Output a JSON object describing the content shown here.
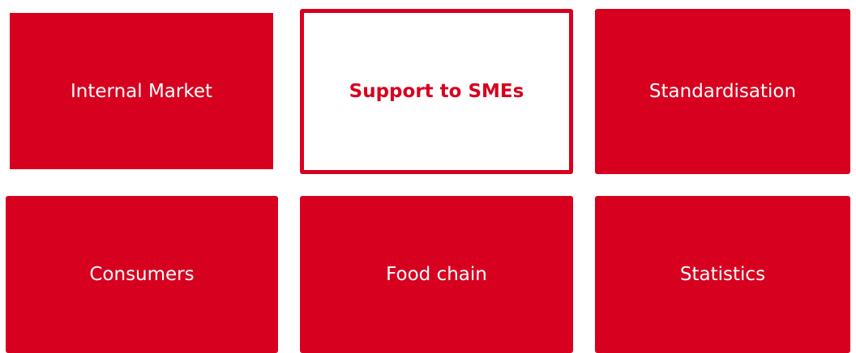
{
  "theme": {
    "accent_color": "#d7001f",
    "text_on_accent": "#ffffff",
    "active_background": "#ffffff"
  },
  "tiles": [
    {
      "label": "Internal Market",
      "active": false
    },
    {
      "label": "Support to SMEs",
      "active": true
    },
    {
      "label": "Standardisation",
      "active": false
    },
    {
      "label": "Consumers",
      "active": false
    },
    {
      "label": "Food chain",
      "active": false
    },
    {
      "label": "Statistics",
      "active": false
    }
  ]
}
